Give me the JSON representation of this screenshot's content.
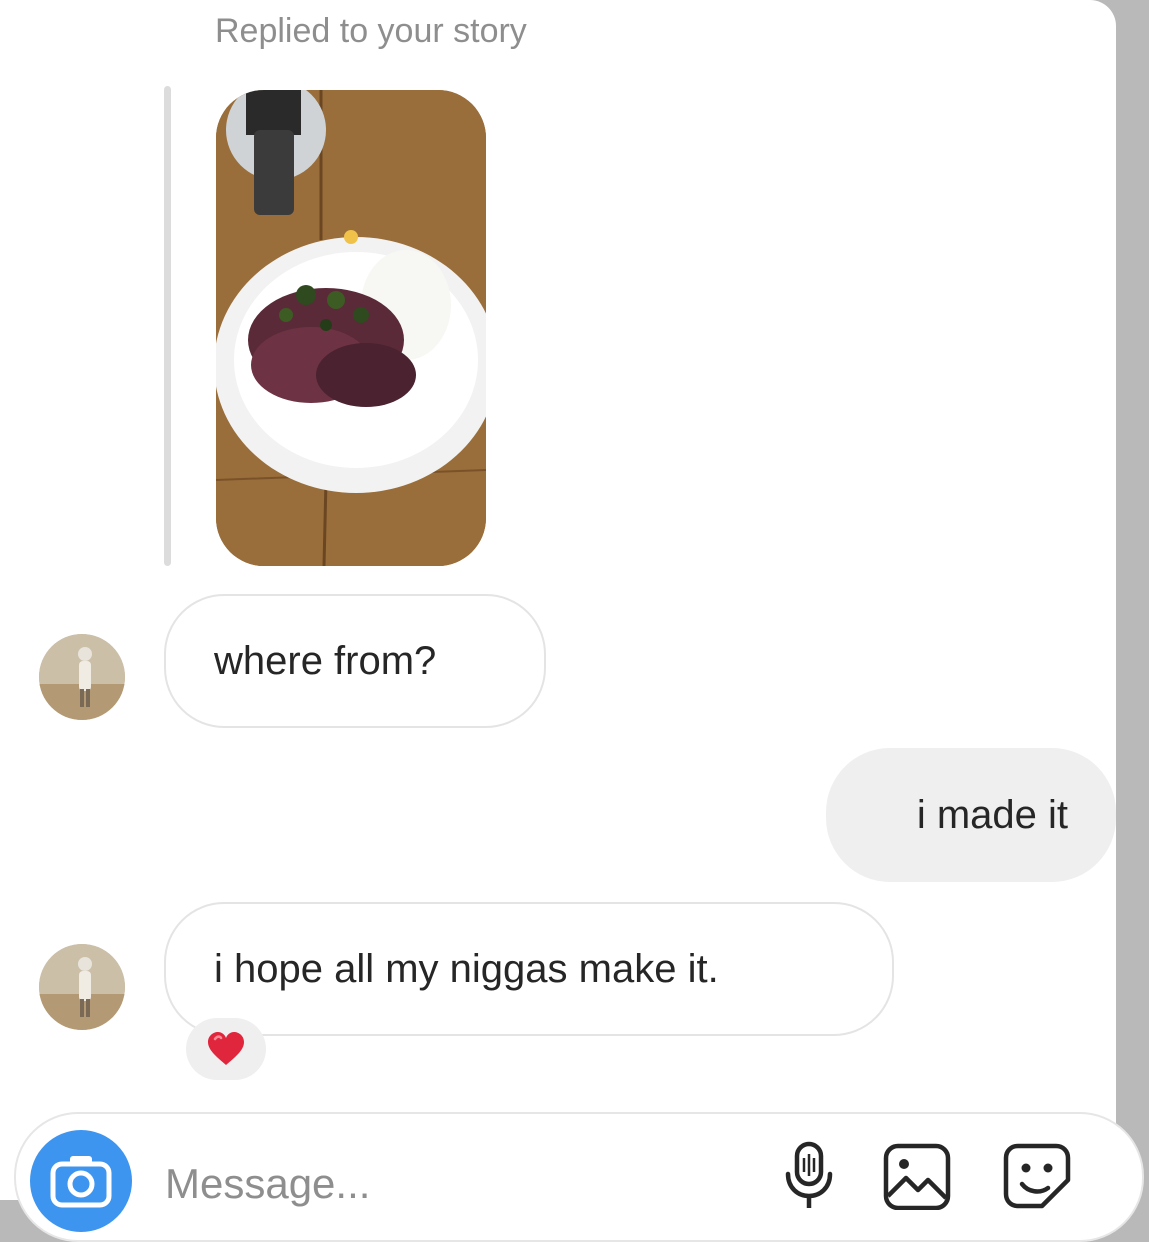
{
  "story_reply": {
    "caption": "Replied to your story"
  },
  "messages": [
    {
      "direction": "incoming",
      "text": "where from?"
    },
    {
      "direction": "outgoing",
      "text": "i made it"
    },
    {
      "direction": "incoming",
      "text": "i hope all my niggas make it.",
      "reaction": "red-heart"
    }
  ],
  "composer": {
    "placeholder": "Message...",
    "camera_icon": "camera-icon",
    "mic_icon": "microphone-icon",
    "gallery_icon": "image-icon",
    "sticker_icon": "sticker-icon"
  },
  "colors": {
    "accent": "#3d95ef",
    "caption": "#8e8e8e",
    "outgoing_bubble": "#efefef",
    "heart": "#e0263d"
  }
}
